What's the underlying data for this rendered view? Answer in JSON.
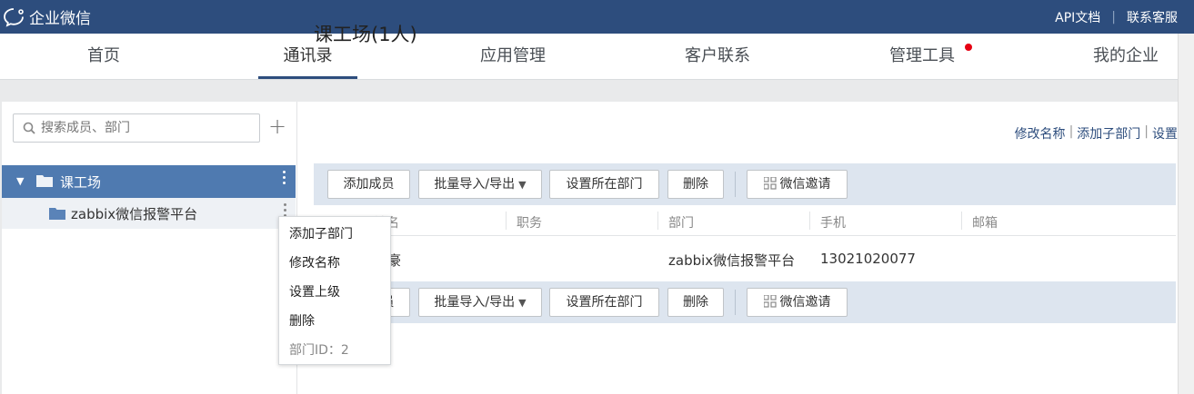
{
  "topbar": {
    "brand": "企业微信",
    "links": [
      "API文档",
      "联系客服"
    ],
    "bg_color": "#2d4d7d"
  },
  "nav": {
    "tabs": [
      {
        "label": "首页"
      },
      {
        "label": "通讯录",
        "active": true
      },
      {
        "label": "应用管理"
      },
      {
        "label": "客户联系"
      },
      {
        "label": "管理工具",
        "badge_dot": true
      },
      {
        "label": "我的企业"
      }
    ]
  },
  "sidebar": {
    "search_placeholder": "搜索成员、部门",
    "tree": [
      {
        "label": "课工场",
        "expanded": true,
        "selected": true
      },
      {
        "label": "zabbix微信报警平台"
      }
    ]
  },
  "main": {
    "title": "课工场(1人)",
    "links": [
      "修改名称",
      "添加子部门",
      "设置"
    ],
    "toolbar": {
      "add_member": "添加成员",
      "import_export": "批量导入/导出",
      "set_dept": "设置所在部门",
      "delete": "删除",
      "wechat_invite": "微信邀请"
    },
    "columns": [
      "姓名",
      "职务",
      "部门",
      "手机",
      "邮箱"
    ],
    "rows": [
      {
        "name": "嘉豪",
        "position": "",
        "department": "zabbix微信报警平台",
        "phone": "13021020077",
        "email": ""
      }
    ]
  },
  "context_menu": {
    "items": [
      "添加子部门",
      "修改名称",
      "设置上级",
      "删除"
    ],
    "dept_id_label": "部门ID：2"
  }
}
